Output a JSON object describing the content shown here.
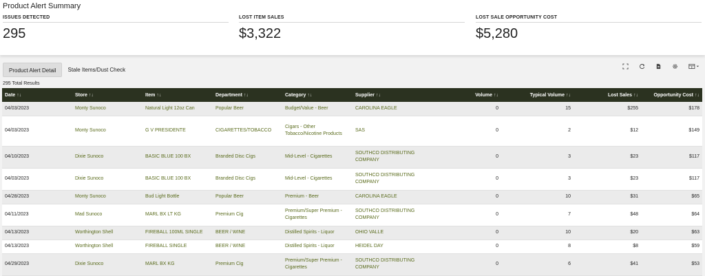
{
  "summary": {
    "title": "Product Alert Summary",
    "metrics": [
      {
        "label": "ISSUES DETECTED",
        "value": "295"
      },
      {
        "label": "LOST ITEM SALES",
        "value": "$3,322"
      },
      {
        "label": "LOST SALE OPPORTUNITY COST",
        "value": "$5,280"
      }
    ]
  },
  "tabs": [
    {
      "label": "Product Alert Detail",
      "active": true
    },
    {
      "label": "Stale Items/Dust Check",
      "active": false
    }
  ],
  "toolbar_icons": [
    "fullscreen-icon",
    "refresh-icon",
    "document-icon",
    "settings-icon",
    "columns-icon"
  ],
  "results_label": "295 Total Results",
  "table": {
    "columns": [
      "Date",
      "Store",
      "Item",
      "Department",
      "Category",
      "Supplier",
      "Volume",
      "Typical Volume",
      "Lost Sales",
      "Opportunity Cost"
    ],
    "sort_glyph": "↑↓",
    "active_sort_glyph": "↑↓",
    "rows": [
      [
        "04/03/2023",
        "Monty Sunoco",
        "Natural Light 12oz Can",
        "Popular Beer",
        "Budget/Value - Beer",
        "CAROLINA EAGLE",
        "0",
        "15",
        "$255",
        "$178"
      ],
      [
        "04/03/2023",
        "Monty Sunoco",
        "G V PRESIDENTE",
        "CIGARETTES/TOBACCO",
        "Cigars - Other Tobacco/Nicotine Products",
        "SAS",
        "0",
        "2",
        "$12",
        "$149"
      ],
      [
        "04/10/2023",
        "Dixie Sunoco",
        "BASIC BLUE 100 BX",
        "Branded Disc Cigs",
        "Mid-Level - Cigarettes",
        "SOUTHCO DISTRIBUTING COMPANY",
        "0",
        "3",
        "$23",
        "$117"
      ],
      [
        "04/03/2023",
        "Dixie Sunoco",
        "BASIC BLUE 100 BX",
        "Branded Disc Cigs",
        "Mid-Level - Cigarettes",
        "SOUTHCO DISTRIBUTING COMPANY",
        "0",
        "3",
        "$23",
        "$117"
      ],
      [
        "04/28/2023",
        "Monty Sunoco",
        "Bud Light Bottle",
        "Popular Beer",
        "Premium - Beer",
        "CAROLINA EAGLE",
        "0",
        "10",
        "$31",
        "$65"
      ],
      [
        "04/11/2023",
        "Mad Sunoco",
        "MARL BX LT KG",
        "Premium Cig",
        "Premium/Super Premium - Cigarettes",
        "SOUTHCO DISTRIBUTING COMPANY",
        "0",
        "7",
        "$48",
        "$64"
      ],
      [
        "04/13/2023",
        "Worthington Shell",
        "FIREBALL 100ML SINGLE",
        "BEER / WINE",
        "Distilled Spirits - Liquor",
        "OHIO VALLE",
        "0",
        "10",
        "$20",
        "$63"
      ],
      [
        "04/13/2023",
        "Worthington Shell",
        "FIREBALL SINGLE",
        "BEER / WINE",
        "Distilled Spirits - Liquor",
        "HEIDEL DAY",
        "0",
        "8",
        "$8",
        "$59"
      ],
      [
        "04/29/2023",
        "Dixie Sunoco",
        "MARL BX KG",
        "Premium Cig",
        "Premium/Super Premium - Cigarettes",
        "SOUTHCO DISTRIBUTING COMPANY",
        "0",
        "6",
        "$41",
        "$53"
      ]
    ]
  }
}
